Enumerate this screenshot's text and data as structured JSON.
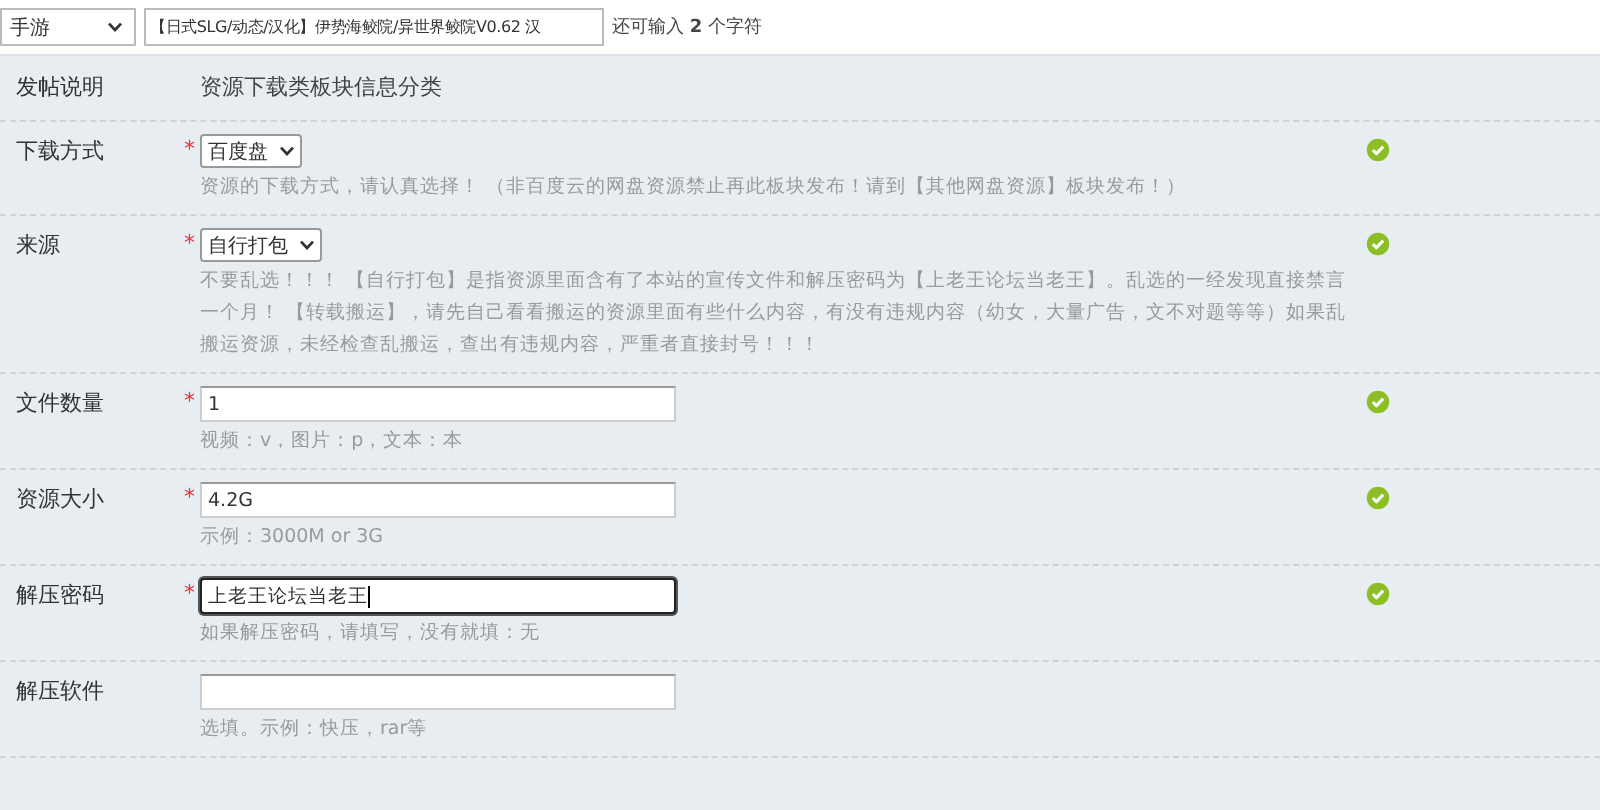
{
  "top_bar": {
    "category_select": {
      "value": "手游"
    },
    "title_field": {
      "value": "【日式SLG/动态/汉化】伊势海鲛院/异世界鲛院V0.62 汉"
    },
    "remaining_hint": "还可输入 **2** 个字符"
  },
  "form_rows": [
    {
      "kind": "static",
      "label": "发帖说明",
      "value": "资源下载类板块信息分类",
      "valid": false
    },
    {
      "kind": "select",
      "label": "下载方式",
      "required_mark": "*",
      "value": "百度盘",
      "description": "资源的下载方式，请认真选择！ （非百度云的网盘资源禁止再此板块发布！请到【其他网盘资源】板块发布！）",
      "valid": true
    },
    {
      "kind": "select",
      "label": "来源",
      "required_mark": "*",
      "value": "自行打包",
      "description": "不要乱选！！！ 【自行打包】是指资源里面含有了本站的宣传文件和解压密码为【上老王论坛当老王】。乱选的一经发现直接禁言一个月！ 【转载搬运】，请先自己看看搬运的资源里面有些什么内容，有没有违规内容（幼女，大量广告，文不对题等等）如果乱搬运资源，未经检查乱搬运，查出有违规内容，严重者直接封号！！！",
      "valid": true
    },
    {
      "kind": "input",
      "label": "文件数量",
      "required_mark": "*",
      "value": "1",
      "focused": false,
      "description": "视频：v，图片：p，文本：本",
      "valid": true
    },
    {
      "kind": "input",
      "label": "资源大小",
      "required_mark": "*",
      "value": "4.2G",
      "focused": false,
      "description": "示例：3000M or 3G",
      "valid": true
    },
    {
      "kind": "input",
      "label": "解压密码",
      "required_mark": "*",
      "value": "上老王论坛当老王",
      "focused": true,
      "description": "如果解压密码，请填写，没有就填：无",
      "valid": true
    },
    {
      "kind": "input",
      "label": "解压软件",
      "focused": false,
      "description": "选填。示例：快压，rar等",
      "valid": false
    }
  ]
}
